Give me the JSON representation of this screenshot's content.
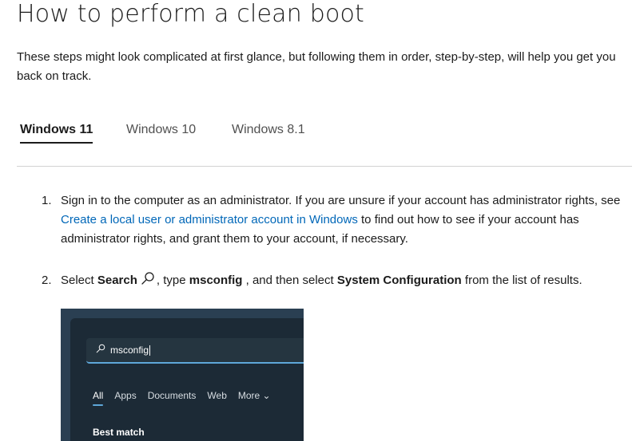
{
  "page": {
    "title": "How to perform a clean boot",
    "intro": "These steps might look complicated at first glance, but following them in order, step-by-step, will help you get you back on track."
  },
  "tabs": [
    {
      "label": "Windows 11",
      "active": true
    },
    {
      "label": "Windows 10",
      "active": false
    },
    {
      "label": "Windows 8.1",
      "active": false
    }
  ],
  "steps": {
    "step1": {
      "num": "1.",
      "text_before": "Sign in to the computer as an administrator. If you are unsure if your account has administrator rights, see ",
      "link": "Create a local user or administrator account in Windows",
      "text_after": " to find out how to see if your account has administrator rights, and grant them to your account, if necessary."
    },
    "step2": {
      "num": "2.",
      "t1": "Select ",
      "b1": "Search",
      "t2": ", type ",
      "b2": "msconfig",
      "t3": " , and then select ",
      "b3": "System Configuration",
      "t4": " from the list of results."
    }
  },
  "screenshot": {
    "search_value": "msconfig",
    "filters": [
      "All",
      "Apps",
      "Documents",
      "Web",
      "More ⌄"
    ],
    "best_match": "Best match"
  },
  "colors": {
    "link": "#0067b8",
    "accent_underline": "#5ea7d9",
    "screenshot_bg": "#1c2a36"
  }
}
